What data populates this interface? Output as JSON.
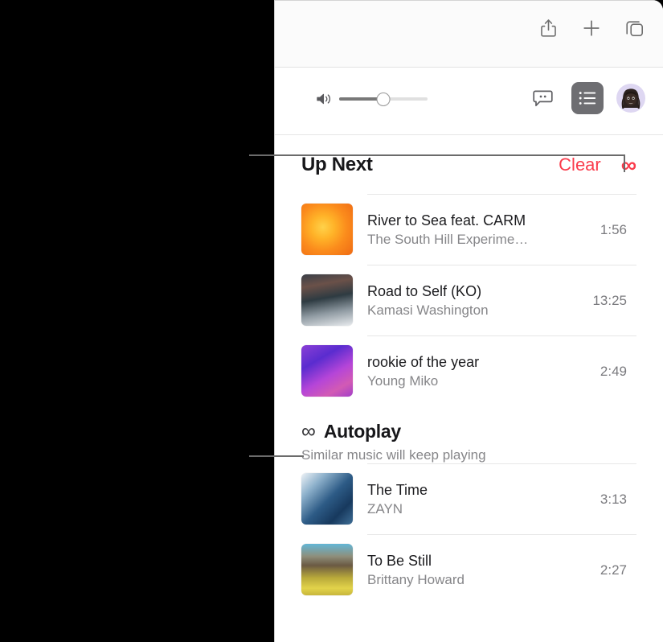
{
  "window": {
    "browser_toolbar": {
      "icons": [
        {
          "name": "share-icon",
          "label": "Share"
        },
        {
          "name": "new-tab-icon",
          "label": "New Tab"
        },
        {
          "name": "tab-overview-icon",
          "label": "Tab Overview"
        }
      ]
    },
    "player_bar": {
      "volume_icon": "speaker-wave-icon",
      "volume_percent": 50,
      "lyrics_icon": "lyrics-bubble-icon",
      "queue_icon": "queue-list-icon",
      "queue_button_active": true,
      "avatar_icon": "user-avatar",
      "accent_active_bg": "#6e6e72",
      "avatar_bg": "#ded7f2"
    }
  },
  "queue": {
    "title": "Up Next",
    "clear_label": "Clear",
    "infinity_icon": "infinity-icon",
    "infinity_glyph": "∞",
    "accent_color": "#fa3c4c",
    "tracks": [
      {
        "title": "River to Sea feat. CARM",
        "artist": "The South Hill Experime…",
        "duration": "1:56",
        "art_css": "radial-gradient(circle at 42% 46%, #ffd24a 0%, #ffb328 28%, #fb8c1c 58%, #ef6a14 100%)"
      },
      {
        "title": "Road to Self (KO)",
        "artist": "Kamasi Washington",
        "duration": "13:25",
        "art_css": "linear-gradient(170deg, #3a3f48 0%, #6b5149 22%, #2e3b42 46%, #8f9aa2 72%, #e9ecef 100%)"
      },
      {
        "title": "rookie of the year",
        "artist": "Young Miko",
        "duration": "2:49",
        "art_css": "linear-gradient(150deg, #8a3fd6 0%, #5a2ccf 30%, #b545d8 58%, #d25ab4 80%, #a33fc9 100%)"
      }
    ]
  },
  "autoplay": {
    "infinity_glyph": "∞",
    "title": "Autoplay",
    "subtitle": "Similar music will keep playing",
    "tracks": [
      {
        "title": "The Time",
        "artist": "ZAYN",
        "duration": "3:13",
        "art_css": "linear-gradient(135deg, #eef3f7 0%, #8fb2cc 24%, #2d5b86 52%, #17395e 76%, #3f6f97 100%)"
      },
      {
        "title": "To Be Still",
        "artist": "Brittany Howard",
        "duration": "2:27",
        "art_css": "linear-gradient(180deg, #63b6d6 0%, #8e8f7c 24%, #6b5a43 42%, #b9a93a 66%, #e2d34a 86%, #c7b63c 100%)"
      }
    ]
  },
  "callouts": {
    "line_color": "#6b6b6b",
    "leader_to_infinity": "points to Up Next infinity button",
    "leader_to_autoplay": "points to Autoplay infinity icon"
  }
}
